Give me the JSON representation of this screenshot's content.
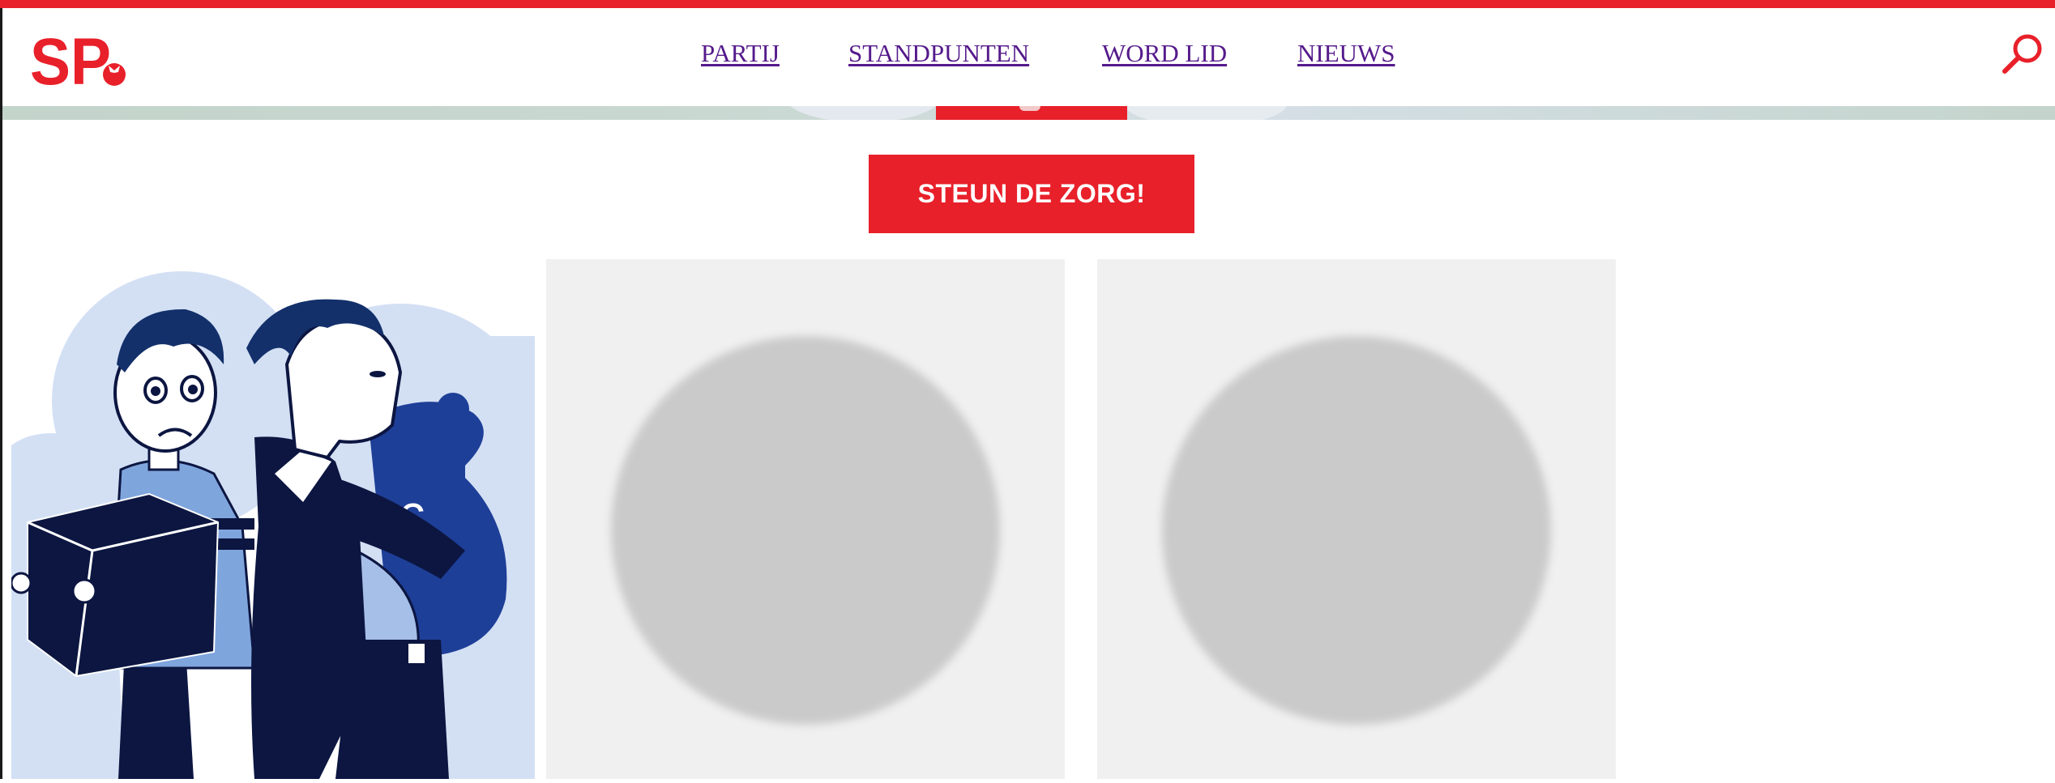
{
  "brand": {
    "logo_text": "SP",
    "accent_color": "#e8202a",
    "link_color": "#551a8b"
  },
  "nav": {
    "items": [
      {
        "label": "PARTIJ"
      },
      {
        "label": "STANDPUNTEN"
      },
      {
        "label": "WORD LID"
      },
      {
        "label": "NIEUWS"
      }
    ]
  },
  "header": {
    "search_icon": "search-icon"
  },
  "cta": {
    "label": "STEUN DE ZORG!"
  },
  "cards": [
    {
      "type": "illustration",
      "icon": "euro-sign"
    },
    {
      "type": "image-placeholder"
    },
    {
      "type": "image-placeholder"
    }
  ]
}
